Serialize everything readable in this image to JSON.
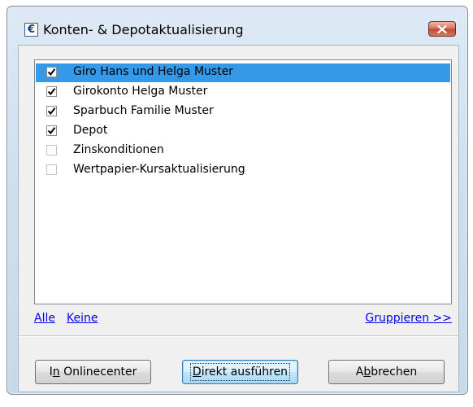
{
  "window": {
    "title": "Konten- & Depotaktualisierung",
    "app_icon_glyph": "€"
  },
  "list": {
    "items": [
      {
        "label": "Giro Hans und Helga Muster",
        "checked": true,
        "selected": true
      },
      {
        "label": "Girokonto Helga Muster",
        "checked": true,
        "selected": false
      },
      {
        "label": "Sparbuch Familie Muster",
        "checked": true,
        "selected": false
      },
      {
        "label": "Depot",
        "checked": true,
        "selected": false
      },
      {
        "label": "Zinskonditionen",
        "checked": false,
        "selected": false
      },
      {
        "label": "Wertpapier-Kursaktualisierung",
        "checked": false,
        "selected": false
      }
    ]
  },
  "links": {
    "all": "Alle",
    "none": "Keine",
    "group": "Gruppieren >>"
  },
  "buttons": {
    "online_center": {
      "pre": "I",
      "mnemonic": "n",
      "post": " Onlinecenter"
    },
    "execute": {
      "pre": "",
      "mnemonic": "D",
      "post": "irekt ausführen"
    },
    "cancel": {
      "pre": "A",
      "mnemonic": "b",
      "post": "brechen"
    }
  },
  "colors": {
    "selection": "#3399e8",
    "link": "#0000ee",
    "close_button": "#c14a32"
  }
}
